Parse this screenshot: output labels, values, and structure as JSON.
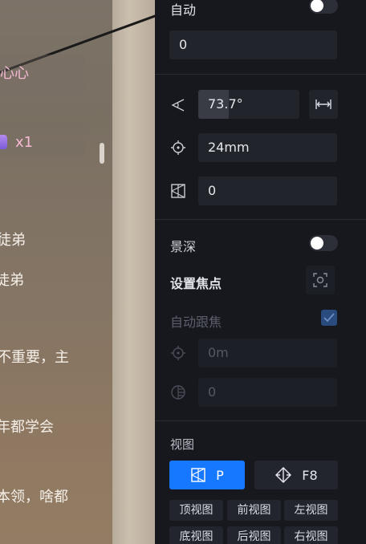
{
  "background": {
    "chat_lines": [
      "心心",
      "x1",
      "徒弟",
      "徒弟",
      "不重要，主",
      "年都学会",
      "本领，啥都"
    ]
  },
  "camera_panel": {
    "auto_label": "自动",
    "auto_toggle_on": false,
    "auto_value": "0",
    "fov_value": "73.7°",
    "fov_fill_percent": 30,
    "focal_length": "24mm",
    "angle_value": "0",
    "depth_of_field_label": "景深",
    "depth_of_field_on": false,
    "set_focus_label": "设置焦点",
    "auto_follow_focus_label": "自动跟焦",
    "auto_follow_focus_checked": true,
    "focus_distance": "0m",
    "aperture_value": "0",
    "view_section_label": "视图",
    "projection_label": "P",
    "shortcut_label": "F8",
    "view_buttons": [
      "顶视图",
      "前视图",
      "左视图",
      "底视图",
      "后视图",
      "右视图"
    ]
  },
  "colors": {
    "panel_bg": "#17181e",
    "accent": "#1677ff",
    "check_bg": "#2a4b7d"
  }
}
